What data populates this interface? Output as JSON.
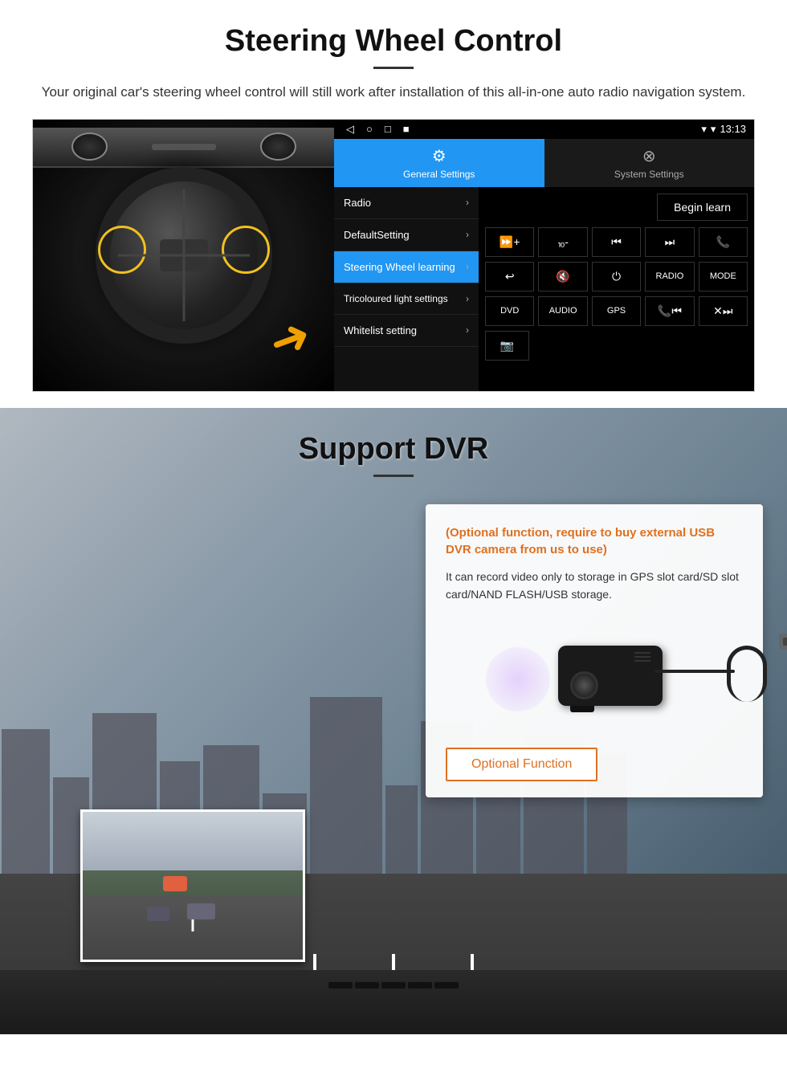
{
  "steering_section": {
    "title": "Steering Wheel Control",
    "description": "Your original car's steering wheel control will still work after installation of this all-in-one auto radio navigation system.",
    "android": {
      "statusbar": {
        "time": "13:13",
        "nav_back": "◁",
        "nav_home": "○",
        "nav_recent": "□",
        "nav_camera": "■"
      },
      "tabs": [
        {
          "label": "General Settings",
          "active": true
        },
        {
          "label": "System Settings",
          "active": false
        }
      ],
      "menu_items": [
        {
          "label": "Radio",
          "active": false
        },
        {
          "label": "DefaultSetting",
          "active": false
        },
        {
          "label": "Steering Wheel learning",
          "active": true
        },
        {
          "label": "Tricoloured light settings",
          "active": false
        },
        {
          "label": "Whitelist setting",
          "active": false
        }
      ],
      "begin_learn_label": "Begin learn",
      "control_buttons": [
        [
          "vol+",
          "vol-",
          "⏮",
          "⏭",
          "📞"
        ],
        [
          "↩",
          "🔇×",
          "⏻",
          "RADIO",
          "MODE"
        ],
        [
          "DVD",
          "AUDIO",
          "GPS",
          "📞⏮",
          "✕⏭"
        ],
        [
          "🎬"
        ]
      ]
    }
  },
  "dvr_section": {
    "title": "Support DVR",
    "card": {
      "highlight_text": "(Optional function, require to buy external USB DVR camera from us to use)",
      "body_text": "It can record video only to storage in GPS slot card/SD slot card/NAND FLASH/USB storage.",
      "optional_function_label": "Optional Function"
    }
  }
}
